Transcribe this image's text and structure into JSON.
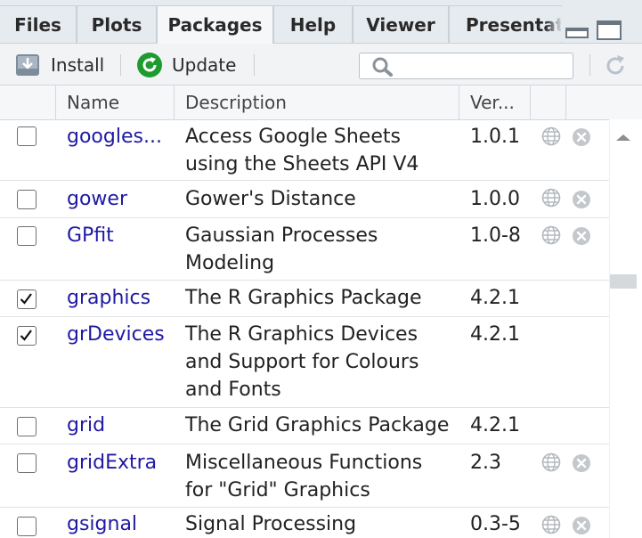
{
  "tabs": [
    {
      "label": "Files",
      "active": false
    },
    {
      "label": "Plots",
      "active": false
    },
    {
      "label": "Packages",
      "active": true
    },
    {
      "label": "Help",
      "active": false
    },
    {
      "label": "Viewer",
      "active": false
    },
    {
      "label": "Presentati",
      "active": false
    }
  ],
  "toolbar": {
    "install_label": "Install",
    "update_label": "Update",
    "search_placeholder": "",
    "search_value": ""
  },
  "table": {
    "headers": {
      "name": "Name",
      "description": "Description",
      "version": "Ver..."
    },
    "rows": [
      {
        "checked": false,
        "name": "googles...",
        "description": "Access Google Sheets using the Sheets API V4",
        "version": "1.0.1",
        "has_web": true,
        "has_delete": true
      },
      {
        "checked": false,
        "name": "gower",
        "description": "Gower's Distance",
        "version": "1.0.0",
        "has_web": true,
        "has_delete": true
      },
      {
        "checked": false,
        "name": "GPfit",
        "description": "Gaussian Processes Modeling",
        "version": "1.0-8",
        "has_web": true,
        "has_delete": true
      },
      {
        "checked": true,
        "name": "graphics",
        "description": "The R Graphics Package",
        "version": "4.2.1",
        "has_web": false,
        "has_delete": false
      },
      {
        "checked": true,
        "name": "grDevices",
        "description": "The R Graphics Devices and Support for Colours and Fonts",
        "version": "4.2.1",
        "has_web": false,
        "has_delete": false
      },
      {
        "checked": false,
        "name": "grid",
        "description": "The Grid Graphics Package",
        "version": "4.2.1",
        "has_web": false,
        "has_delete": false
      },
      {
        "checked": false,
        "name": "gridExtra",
        "description": "Miscellaneous Functions for \"Grid\" Graphics",
        "version": "2.3",
        "has_web": true,
        "has_delete": true
      },
      {
        "checked": false,
        "name": "gsignal",
        "description": "Signal Processing",
        "version": "0.3-5",
        "has_web": true,
        "has_delete": true
      }
    ]
  },
  "icons": {
    "install": "install-box-icon",
    "update": "update-circular-arrow-icon",
    "search": "search-icon",
    "refresh": "refresh-icon",
    "web": "globe-icon",
    "delete": "remove-circle-x-icon",
    "minimize": "minimize-icon",
    "maximize": "maximize-icon",
    "scroll_up": "scroll-up-arrow-icon"
  },
  "colors": {
    "package_link": "#1f1aa3",
    "update_green": "#1e9b2f",
    "tab_bg": "#e6ebf0",
    "active_tab_bg": "#f5f7f9"
  }
}
